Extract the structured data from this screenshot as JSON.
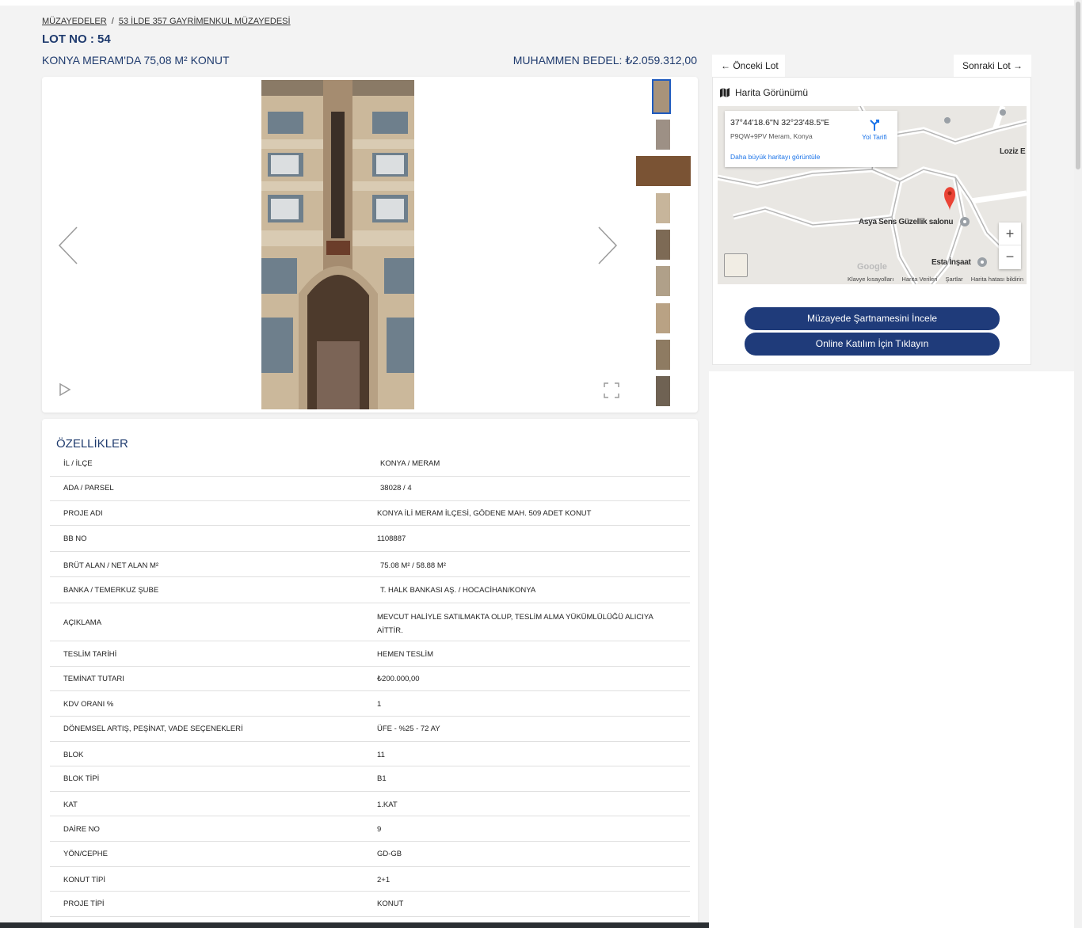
{
  "breadcrumb": {
    "items": [
      "MÜZAYEDELER",
      "53 İLDE 357 GAYRİMENKUL MÜZAYEDESİ"
    ],
    "separator": "/"
  },
  "lot": {
    "number_label": "LOT NO : 54",
    "title": "KONYA MERAM'DA 75,08 M² KONUT",
    "price_label": "MUHAMMEN BEDEL: ₺2.059.312,00"
  },
  "navigation": {
    "prev_label": "Önceki Lot",
    "next_label": "Sonraki Lot"
  },
  "gallery": {
    "thumbnail_count": 9,
    "active_index": 0
  },
  "map": {
    "header": "Harita Görünümü",
    "coords": "37°44'18.6\"N 32°23'48.5\"E",
    "plus_code": "P9QW+9PV Meram, Konya",
    "bigger_map_link": "Daha büyük haritayı görüntüle",
    "directions_label": "Yol Tarifi",
    "place_labels": [
      "Asya Sens Güzellik salonu",
      "Esta İnşaat",
      "Loziz E"
    ],
    "google_logo": "Google",
    "footer_links": [
      "Klavye kısayolları",
      "Harita Verileri",
      "Şartlar",
      "Harita hatası bildirin"
    ],
    "zoom_in": "+",
    "zoom_out": "−"
  },
  "actions": {
    "spec_button": "Müzayede Şartnamesini İncele",
    "online_button": "Online Katılım İçin Tıklayın"
  },
  "features": {
    "heading": "ÖZELLİKLER",
    "rows": [
      {
        "key": "İL / İLÇE",
        "value": "KONYA / MERAM"
      },
      {
        "key": "ADA / PARSEL",
        "value": "38028 / 4"
      },
      {
        "key": "PROJE ADI",
        "value": "KONYA İLİ MERAM İLÇESİ, GÖDENE MAH. 509 ADET KONUT"
      },
      {
        "key": "BB NO",
        "value": "1108887"
      },
      {
        "key": "BRÜT ALAN / NET ALAN M²",
        "value": "75.08 M² / 58.88 M²"
      },
      {
        "key": "BANKA / TEMERKUZ ŞUBE",
        "value": "T. HALK BANKASI AŞ. / HOCACİHAN/KONYA"
      },
      {
        "key": "AÇIKLAMA",
        "value": "MEVCUT HALİYLE SATILMAKTA OLUP, TESLİM ALMA YÜKÜMLÜLÜĞÜ ALICIYA AİTTİR."
      },
      {
        "key": "TESLİM TARİHİ",
        "value": "HEMEN TESLİM"
      },
      {
        "key": "TEMİNAT TUTARI",
        "value": "₺200.000,00"
      },
      {
        "key": "KDV ORANI %",
        "value": "1"
      },
      {
        "key": "DÖNEMSEL ARTIŞ, PEŞİNAT, VADE SEÇENEKLERİ",
        "value": "ÜFE - %25 - 72 AY"
      },
      {
        "key": "BLOK",
        "value": "11"
      },
      {
        "key": "BLOK TİPİ",
        "value": "B1"
      },
      {
        "key": "KAT",
        "value": "1.KAT"
      },
      {
        "key": "DAİRE NO",
        "value": "9"
      },
      {
        "key": "YÖN/CEPHE",
        "value": "GD-GB"
      },
      {
        "key": "KONUT TİPİ",
        "value": "2+1"
      },
      {
        "key": "PROJE TİPİ",
        "value": "KONUT"
      }
    ]
  },
  "colors": {
    "brand_blue": "#1f3b6e",
    "button_blue": "#1f3b7a",
    "map_pin": "#ea4335"
  }
}
